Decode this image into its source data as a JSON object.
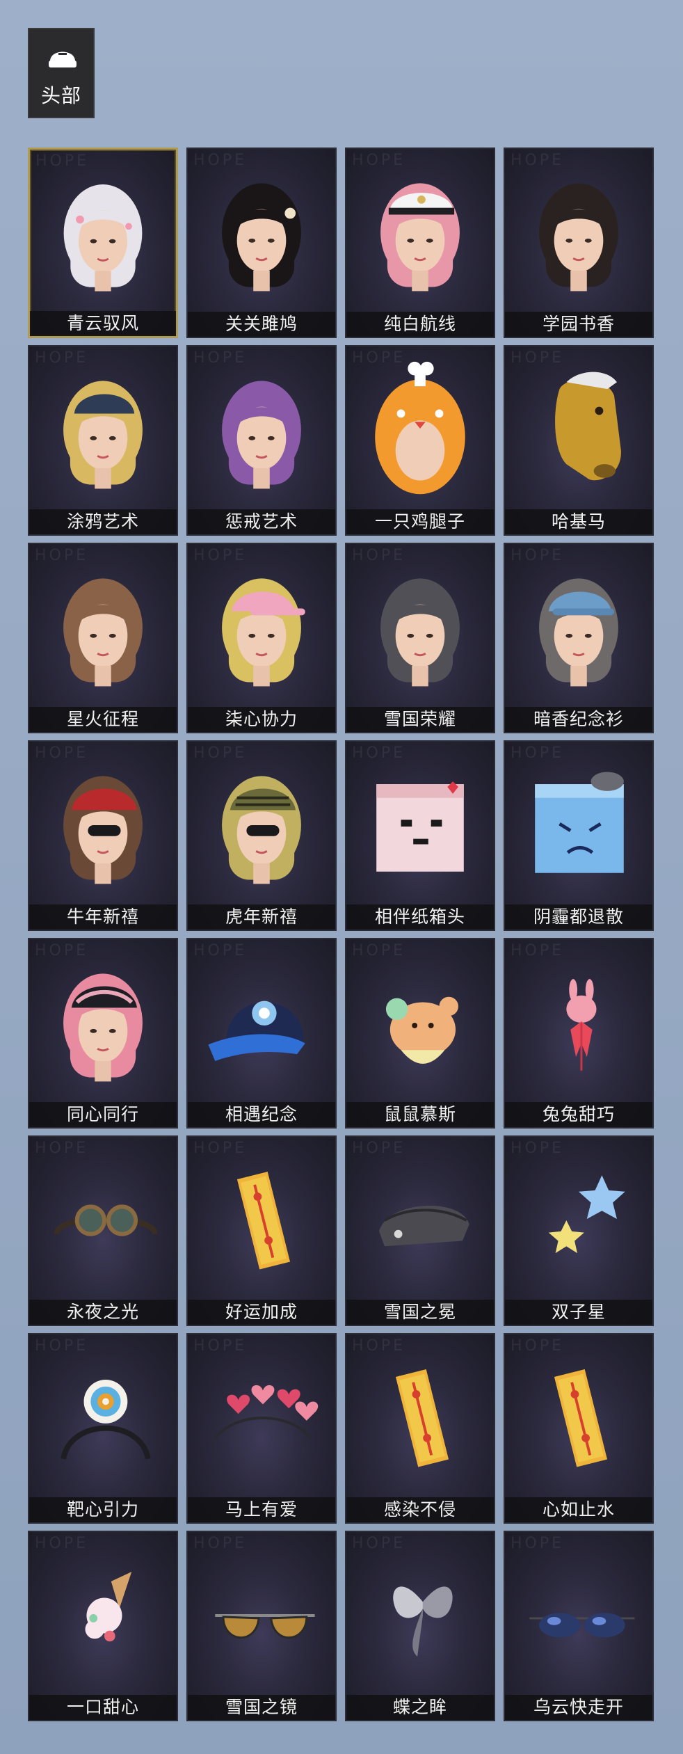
{
  "category": {
    "label": "头部",
    "icon": "hat-icon"
  },
  "watermark": "HOPE",
  "items": [
    {
      "name": "青云驭风",
      "kind": "head-white"
    },
    {
      "name": "关关雎鸠",
      "kind": "head-black"
    },
    {
      "name": "纯白航线",
      "kind": "head-pink-captain"
    },
    {
      "name": "学园书香",
      "kind": "head-dark"
    },
    {
      "name": "涂鸦艺术",
      "kind": "head-blonde-beanie"
    },
    {
      "name": "惩戒艺术",
      "kind": "head-purple"
    },
    {
      "name": "一只鸡腿子",
      "kind": "chicken-leg-hood"
    },
    {
      "name": "哈基马",
      "kind": "horse-mask"
    },
    {
      "name": "星火征程",
      "kind": "head-brown"
    },
    {
      "name": "柒心协力",
      "kind": "head-blonde-cap"
    },
    {
      "name": "雪国荣耀",
      "kind": "head-gray"
    },
    {
      "name": "暗香纪念衫",
      "kind": "head-cap-blue"
    },
    {
      "name": "牛年新禧",
      "kind": "head-red-cap"
    },
    {
      "name": "虎年新禧",
      "kind": "head-tiger-cap"
    },
    {
      "name": "相伴纸箱头",
      "kind": "pink-box"
    },
    {
      "name": "阴霾都退散",
      "kind": "blue-box"
    },
    {
      "name": "同心同行",
      "kind": "head-pink-cap"
    },
    {
      "name": "相遇纪念",
      "kind": "baseball-cap"
    },
    {
      "name": "鼠鼠慕斯",
      "kind": "mousse"
    },
    {
      "name": "兔兔甜巧",
      "kind": "bunny-pin"
    },
    {
      "name": "永夜之光",
      "kind": "goggles"
    },
    {
      "name": "好运加成",
      "kind": "talisman"
    },
    {
      "name": "雪国之冕",
      "kind": "garrison-cap"
    },
    {
      "name": "双子星",
      "kind": "twin-stars"
    },
    {
      "name": "靶心引力",
      "kind": "target-headband"
    },
    {
      "name": "马上有爱",
      "kind": "hearts-headband"
    },
    {
      "name": "感染不侵",
      "kind": "talisman"
    },
    {
      "name": "心如止水",
      "kind": "talisman"
    },
    {
      "name": "一口甜心",
      "kind": "ice-cream"
    },
    {
      "name": "雪国之镜",
      "kind": "aviators"
    },
    {
      "name": "蝶之眸",
      "kind": "butterfly"
    },
    {
      "name": "乌云快走开",
      "kind": "cloud-glasses"
    }
  ],
  "selected_index": 0
}
